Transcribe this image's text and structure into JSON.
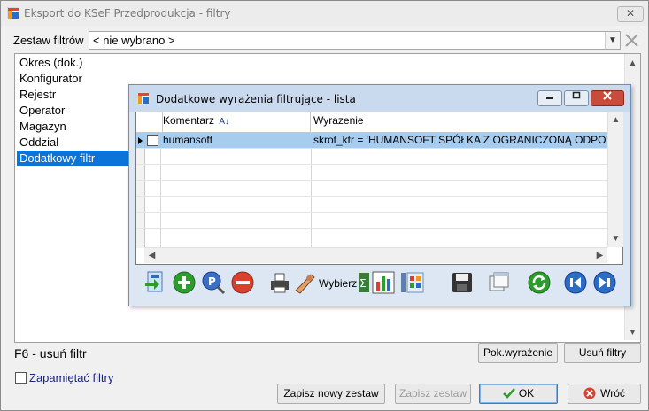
{
  "window": {
    "title": "Eksport do KSeF Przedprodukcja - filtry",
    "close_glyph": "✕"
  },
  "filter_set": {
    "label": "Zestaw filtrów",
    "value": "< nie wybrano >"
  },
  "filters_list": {
    "items": [
      "Okres (dok.)",
      "Konfigurator",
      "Rejestr",
      "Operator",
      "Magazyn",
      "Oddział",
      "Dodatkowy filtr"
    ],
    "selected_index": 6
  },
  "hint": "F6 - usuń filtr",
  "buttons": {
    "show_expression": "Pok.wyrażenie",
    "remove_filter": "Usuń filtry",
    "save_new_set": "Zapisz nowy zestaw",
    "save_set": "Zapisz zestaw",
    "ok": "OK",
    "back": "Wróć"
  },
  "remember_filters": {
    "label": "Zapamiętać filtry",
    "checked": false
  },
  "dialog": {
    "title": "Dodatkowe wyrażenia filtrujące - lista",
    "columns": [
      "Komentarz",
      "Wyrazenie"
    ],
    "sort_badge": "A↓",
    "rows": [
      {
        "comment": "humansoft",
        "expression": "skrot_ktr = 'HUMANSOFT SPÓŁKA Z OGRANICZONĄ ODPOW"
      }
    ],
    "toolbar_label": "Wybierz"
  },
  "colors": {
    "selection": "#0a74da",
    "row_selection": "#a6cdf0",
    "dialog_title": "#c9daee"
  }
}
